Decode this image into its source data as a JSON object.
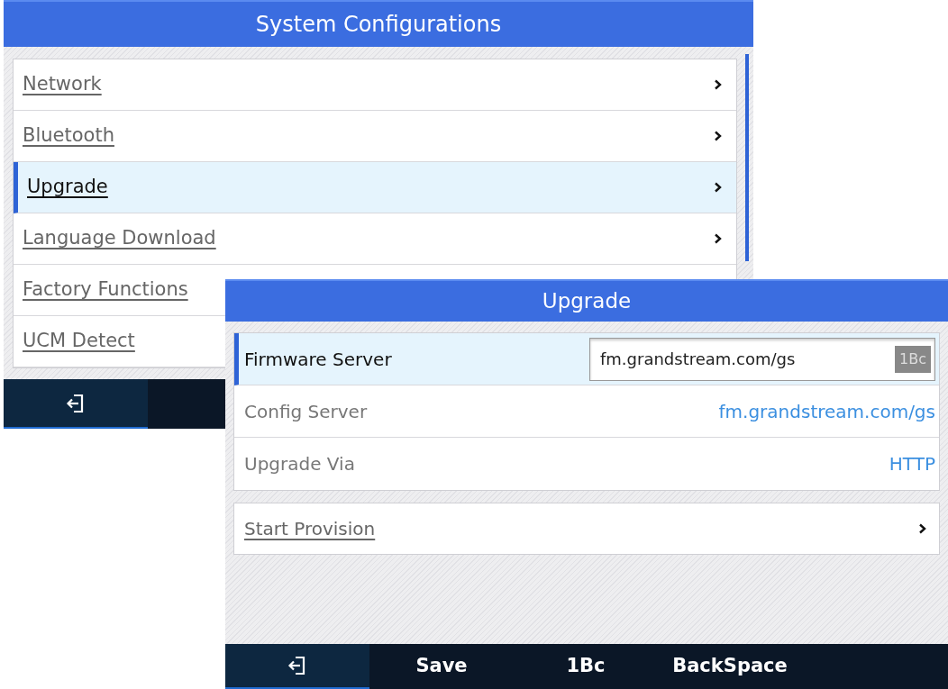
{
  "back_window": {
    "title": "System Configurations",
    "items": [
      {
        "label": "Network",
        "selected": false,
        "chevron": true
      },
      {
        "label": "Bluetooth",
        "selected": false,
        "chevron": true
      },
      {
        "label": "Upgrade",
        "selected": true,
        "chevron": true
      },
      {
        "label": "Language Download",
        "selected": false,
        "chevron": true
      },
      {
        "label": "Factory Functions",
        "selected": false,
        "chevron": false
      },
      {
        "label": "UCM Detect",
        "selected": false,
        "chevron": false
      }
    ],
    "softkeys": [
      {
        "kind": "exit"
      }
    ]
  },
  "front_window": {
    "title": "Upgrade",
    "fields": [
      {
        "kind": "input",
        "label": "Firmware Server",
        "value": "fm.grandstream.com/gs",
        "input_mode": "1Bc",
        "selected": true
      },
      {
        "kind": "value",
        "label": "Config Server",
        "value": "fm.grandstream.com/gs",
        "selected": false
      },
      {
        "kind": "value",
        "label": "Upgrade Via",
        "value": "HTTP",
        "selected": false
      }
    ],
    "actions": [
      {
        "label": "Start Provision"
      }
    ],
    "softkeys": [
      {
        "kind": "exit"
      },
      {
        "kind": "text",
        "label": "Save"
      },
      {
        "kind": "text",
        "label": "1Bc"
      },
      {
        "kind": "text",
        "label": "BackSpace"
      }
    ]
  }
}
